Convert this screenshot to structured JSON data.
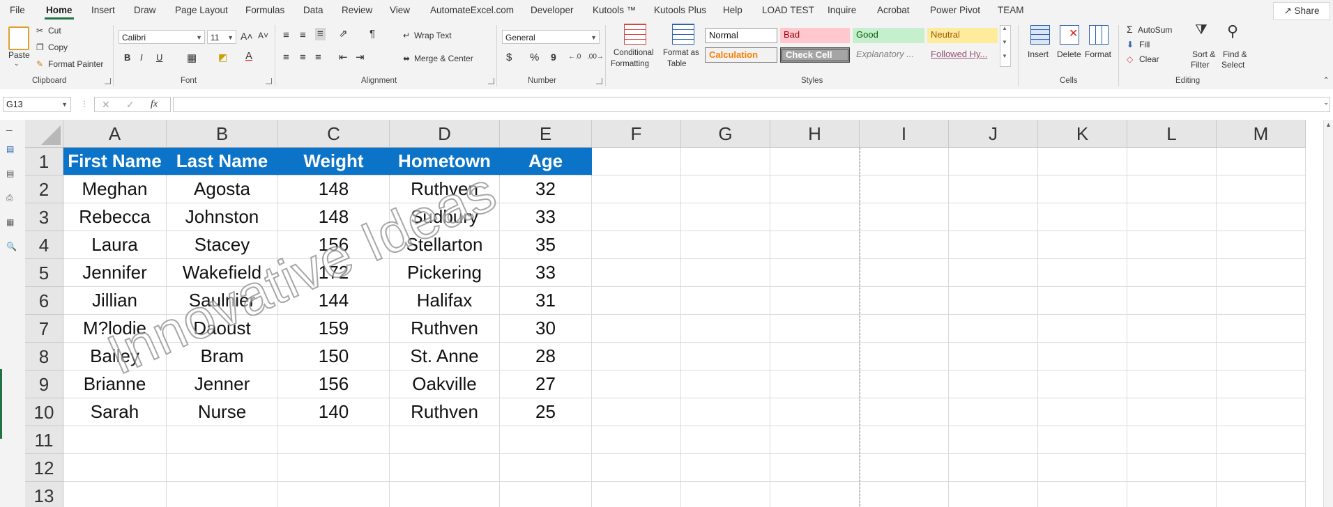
{
  "tabs": [
    "File",
    "Home",
    "Insert",
    "Draw",
    "Page Layout",
    "Formulas",
    "Data",
    "Review",
    "View",
    "AutomateExcel.com",
    "Developer",
    "Kutools ™",
    "Kutools Plus",
    "Help",
    "LOAD TEST",
    "Inquire",
    "Acrobat",
    "Power Pivot",
    "TEAM"
  ],
  "share_label": "Share",
  "clipboard": {
    "paste": "Paste",
    "cut": "Cut",
    "copy": "Copy",
    "format_painter": "Format Painter",
    "group": "Clipboard"
  },
  "font": {
    "name": "Calibri",
    "size": "11",
    "bold": "B",
    "italic": "I",
    "underline": "U",
    "group": "Font"
  },
  "alignment": {
    "wrap_text": "Wrap Text",
    "merge_center": "Merge & Center",
    "group": "Alignment"
  },
  "number": {
    "format": "General",
    "dollar": "$",
    "percent": "%",
    "comma": "9",
    "group": "Number"
  },
  "styles": {
    "conditional_formatting": [
      "Conditional",
      "Formatting"
    ],
    "format_as_table": [
      "Format as",
      "Table"
    ],
    "cells": [
      "Normal",
      "Bad",
      "Good",
      "Neutral",
      "Calculation",
      "Check Cell",
      "Explanatory ...",
      "Followed Hy..."
    ],
    "group": "Styles"
  },
  "cells_group": {
    "insert": "Insert",
    "delete": "Delete",
    "format": "Format",
    "group": "Cells"
  },
  "editing": {
    "autosum": "AutoSum",
    "fill": "Fill",
    "clear": "Clear",
    "sort_filter": [
      "Sort &",
      "Filter"
    ],
    "find_select": [
      "Find &",
      "Select"
    ],
    "group": "Editing"
  },
  "name_box": "G13",
  "fx": "fx",
  "columns": [
    "A",
    "B",
    "C",
    "D",
    "E",
    "F",
    "G",
    "H",
    "I",
    "J",
    "K",
    "L",
    "M"
  ],
  "rows": [
    "1",
    "2",
    "3",
    "4",
    "5",
    "6",
    "7",
    "8",
    "9",
    "10",
    "11",
    "12",
    "13"
  ],
  "table": {
    "headers": [
      "First Name",
      "Last Name",
      "Weight",
      "Hometown",
      "Age"
    ],
    "data": [
      [
        "Meghan",
        "Agosta",
        "148",
        "Ruthven",
        "32"
      ],
      [
        "Rebecca",
        "Johnston",
        "148",
        "Sudbury",
        "33"
      ],
      [
        "Laura",
        "Stacey",
        "156",
        "Stellarton",
        "35"
      ],
      [
        "Jennifer",
        "Wakefield",
        "172",
        "Pickering",
        "33"
      ],
      [
        "Jillian",
        "Saulnier",
        "144",
        "Halifax",
        "31"
      ],
      [
        "M?lodie",
        "Daoust",
        "159",
        "Ruthven",
        "30"
      ],
      [
        "Bailey",
        "Bram",
        "150",
        "St. Anne",
        "28"
      ],
      [
        "Brianne",
        "Jenner",
        "156",
        "Oakville",
        "27"
      ],
      [
        "Sarah",
        "Nurse",
        "140",
        "Ruthven",
        "25"
      ]
    ]
  },
  "watermark": "Innovative Ideas",
  "colors": {
    "header_fill": "#0b74c8",
    "accent": "#217346"
  }
}
